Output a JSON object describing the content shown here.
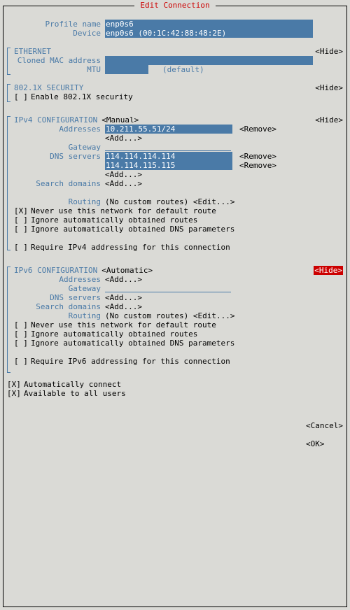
{
  "title": "Edit Connection",
  "profile": {
    "name_label": "Profile name",
    "name_value": "enp0s6",
    "device_label": "Device",
    "device_value": "enp0s6 (00:1C:42:88:48:2E)"
  },
  "ethernet": {
    "header": "ETHERNET",
    "hide": "<Hide>",
    "cloned_mac_label": "Cloned MAC address",
    "cloned_mac_value": "",
    "mtu_label": "MTU",
    "mtu_value": "",
    "mtu_default": "(default)"
  },
  "sec8021x": {
    "header": "802.1X SECURITY",
    "hide": "<Hide>",
    "enable_check": "[ ]",
    "enable_label": "Enable 802.1X security"
  },
  "ipv4": {
    "header": "IPv4 CONFIGURATION",
    "mode": "<Manual>",
    "hide": "<Hide>",
    "addresses_label": "Addresses",
    "addresses": [
      "10.211.55.51/24"
    ],
    "add": "<Add...>",
    "remove": "<Remove>",
    "gateway_label": "Gateway",
    "gateway_value": "",
    "dns_label": "DNS servers",
    "dns": [
      "114.114.114.114",
      "114.114.115.115"
    ],
    "search_label": "Search domains",
    "routing_label": "Routing",
    "routing_none": "(No custom routes)",
    "routing_edit": "<Edit...>",
    "c1": {
      "mark": "[X]",
      "text": "Never use this network for default route"
    },
    "c2": {
      "mark": "[ ]",
      "text": "Ignore automatically obtained routes"
    },
    "c3": {
      "mark": "[ ]",
      "text": "Ignore automatically obtained DNS parameters"
    },
    "c4": {
      "mark": "[ ]",
      "text": "Require IPv4 addressing for this connection"
    }
  },
  "ipv6": {
    "header": "IPv6 CONFIGURATION",
    "mode": "<Automatic>",
    "hide": "<Hide>",
    "addresses_label": "Addresses",
    "add": "<Add...>",
    "gateway_label": "Gateway",
    "dns_label": "DNS servers",
    "search_label": "Search domains",
    "routing_label": "Routing",
    "routing_none": "(No custom routes)",
    "routing_edit": "<Edit...>",
    "c1": {
      "mark": "[ ]",
      "text": "Never use this network for default route"
    },
    "c2": {
      "mark": "[ ]",
      "text": "Ignore automatically obtained routes"
    },
    "c3": {
      "mark": "[ ]",
      "text": "Ignore automatically obtained DNS parameters"
    },
    "c4": {
      "mark": "[ ]",
      "text": "Require IPv6 addressing for this connection"
    }
  },
  "footer": {
    "auto_mark": "[X]",
    "auto_label": "Automatically connect",
    "avail_mark": "[X]",
    "avail_label": "Available to all users",
    "cancel": "<Cancel>",
    "ok": "<OK>"
  }
}
